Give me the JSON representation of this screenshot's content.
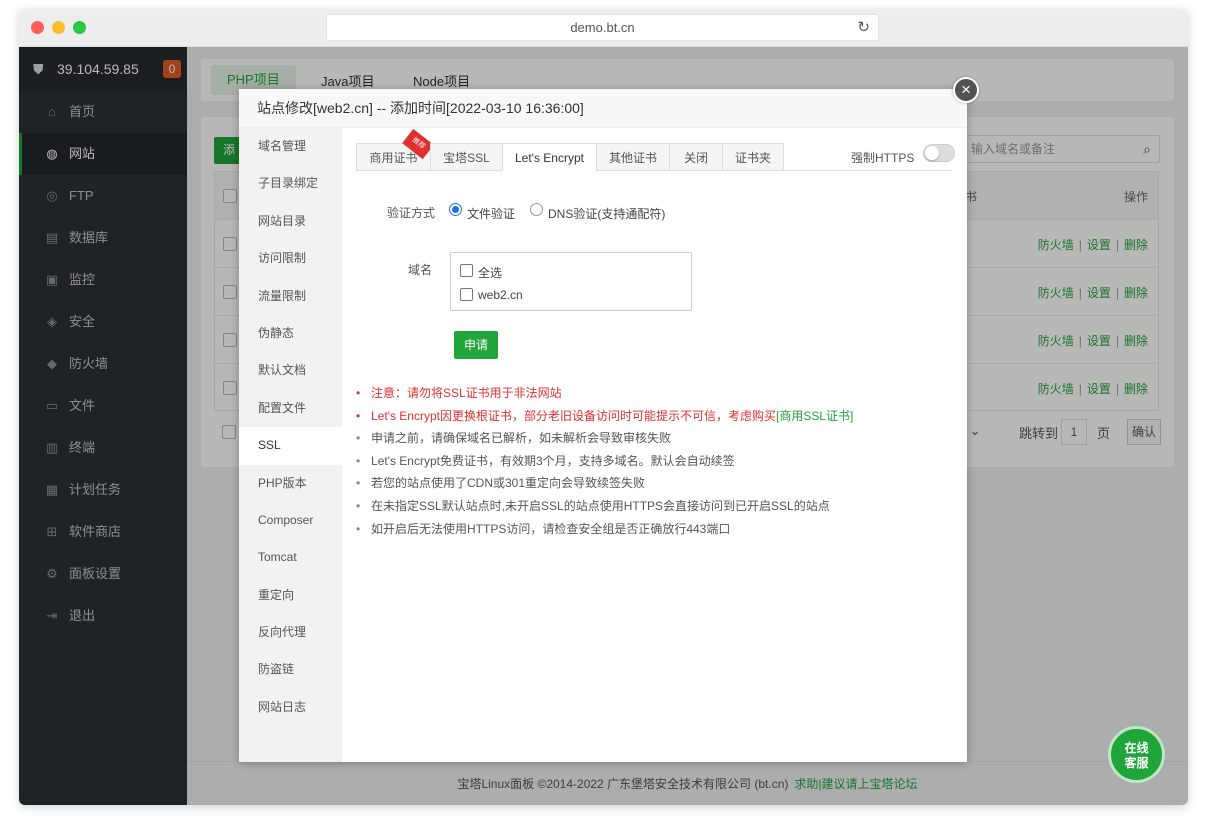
{
  "browser": {
    "url": "demo.bt.cn"
  },
  "sidebar": {
    "ip": "39.104.59.85",
    "badge": "0",
    "items": [
      {
        "label": "首页",
        "icon": "home-icon"
      },
      {
        "label": "网站",
        "icon": "globe-icon"
      },
      {
        "label": "FTP",
        "icon": "ftp-icon"
      },
      {
        "label": "数据库",
        "icon": "database-icon"
      },
      {
        "label": "监控",
        "icon": "monitor-icon"
      },
      {
        "label": "安全",
        "icon": "shield-icon"
      },
      {
        "label": "防火墙",
        "icon": "firewall-icon"
      },
      {
        "label": "文件",
        "icon": "folder-icon"
      },
      {
        "label": "终端",
        "icon": "terminal-icon"
      },
      {
        "label": "计划任务",
        "icon": "calendar-icon"
      },
      {
        "label": "软件商店",
        "icon": "apps-icon"
      },
      {
        "label": "面板设置",
        "icon": "gear-icon"
      },
      {
        "label": "退出",
        "icon": "logout-icon"
      }
    ]
  },
  "project_tabs": [
    "PHP项目",
    "Java项目",
    "Node项目"
  ],
  "site_list": {
    "add_label": "添",
    "search_placeholder": "输入域名或备注",
    "header_cert": "书",
    "header_ops": "操作",
    "ops": [
      "防火墙",
      "设置",
      "删除"
    ],
    "pager": {
      "select": "页",
      "jump": "跳转到",
      "page": "1",
      "page_unit": "页",
      "confirm": "确认"
    }
  },
  "footer": {
    "copyright": "宝塔Linux面板 ©2014-2022 广东堡塔安全技术有限公司 (bt.cn)",
    "link": "求助|建议请上宝塔论坛"
  },
  "modal": {
    "title": "站点修改[web2.cn] -- 添加时间[2022-03-10 16:36:00]",
    "close": "×",
    "nav": [
      "域名管理",
      "子目录绑定",
      "网站目录",
      "访问限制",
      "流量限制",
      "伪静态",
      "默认文档",
      "配置文件",
      "SSL",
      "PHP版本",
      "Composer",
      "Tomcat",
      "重定向",
      "反向代理",
      "防盗链",
      "网站日志"
    ],
    "ssl_tabs": [
      "商用证书",
      "宝塔SSL",
      "Let's Encrypt",
      "其他证书",
      "关闭",
      "证书夹"
    ],
    "ribbon": "推荐",
    "force_https_label": "强制HTTPS",
    "verify_label": "验证方式",
    "verify_options": [
      "文件验证",
      "DNS验证(支持通配符)"
    ],
    "domain_label": "域名",
    "domain_options": [
      "全选",
      "web2.cn"
    ],
    "apply_label": "申请",
    "notes": [
      "注意：请勿将SSL证书用于非法网站",
      "Let's Encrypt因更换根证书，部分老旧设备访问时可能提示不可信，考虑购买",
      "申请之前，请确保域名已解析，如未解析会导致审核失败",
      "Let's Encrypt免费证书，有效期3个月，支持多域名。默认会自动续签",
      "若您的站点使用了CDN或301重定向会导致续签失败",
      "在未指定SSL默认站点时,未开启SSL的站点使用HTTPS会直接访问到已开启SSL的站点",
      "如开启后无法使用HTTPS访问，请检查安全组是否正确放行443端口"
    ],
    "note_link": "[商用SSL证书]"
  },
  "chat": {
    "line1": "在线",
    "line2": "客服"
  },
  "colors": {
    "accent": "#20a53a",
    "sidebar_bg": "#2c3138",
    "warning": "#e02f2f"
  }
}
